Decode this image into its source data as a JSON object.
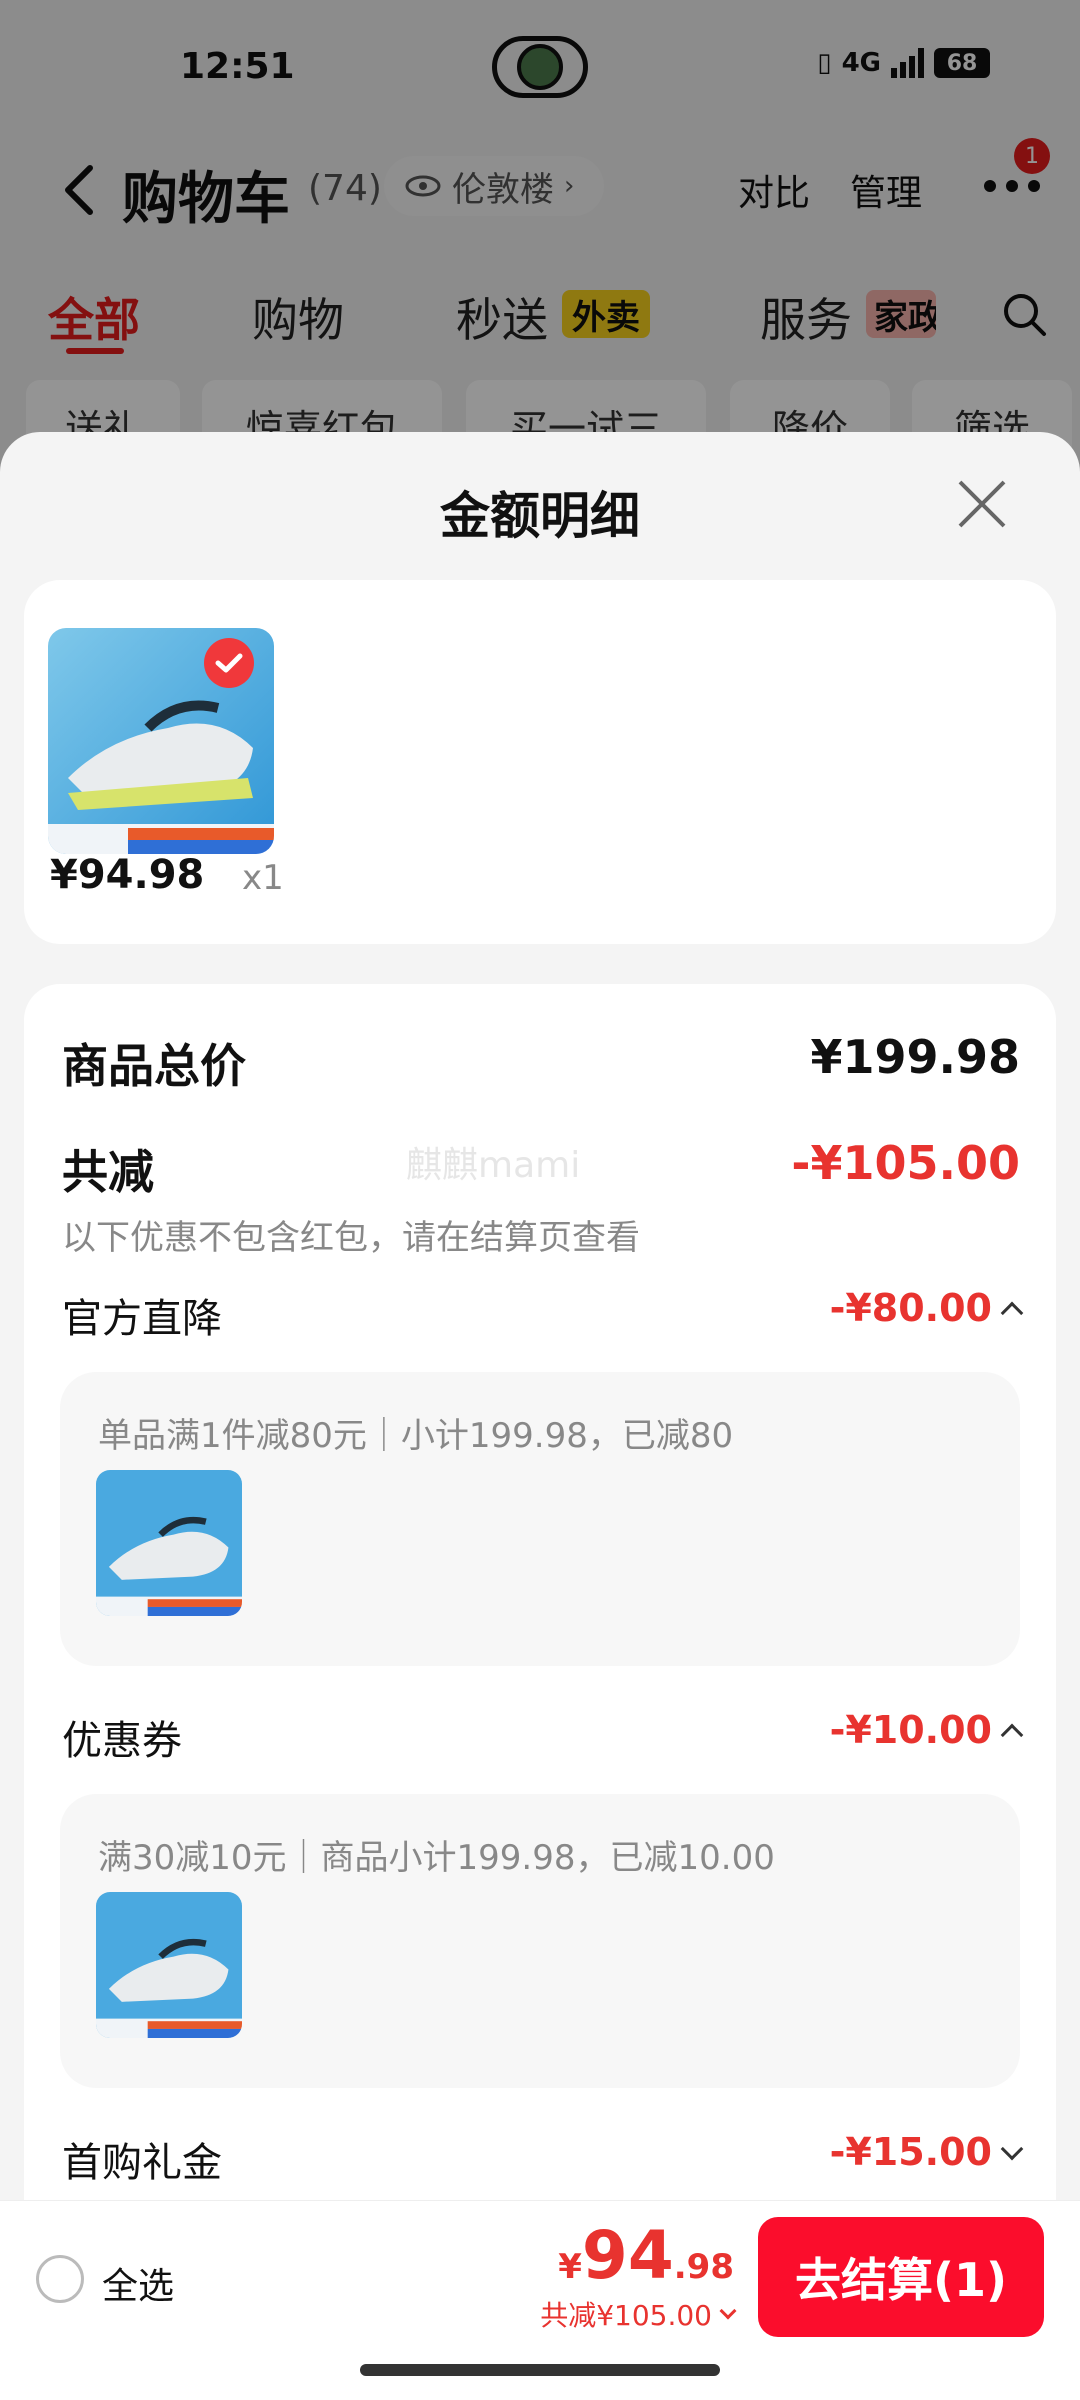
{
  "status": {
    "time": "12:51",
    "network": "4G",
    "battery": "68"
  },
  "header": {
    "title": "购物车",
    "count": "(74)",
    "location": "伦敦楼",
    "compare": "对比",
    "manage": "管理",
    "badge": "1"
  },
  "tabs": [
    {
      "label": "全部"
    },
    {
      "label": "购物"
    },
    {
      "label": "秒送",
      "tag": "外卖"
    },
    {
      "label": "服务",
      "tag": "家政"
    }
  ],
  "chips": [
    "送礼",
    "惊喜红包",
    "买一试三",
    "降价",
    "筛选"
  ],
  "sheet": {
    "title": "金额明细",
    "product": {
      "price": "¥94.98",
      "qty": "x1"
    },
    "total_label": "商品总价",
    "total_value": "¥199.98",
    "reduce_label": "共减",
    "reduce_value": "-¥105.00",
    "note": "以下优惠不包含红包，请在结算页查看",
    "watermark": "麒麒mami",
    "discounts": [
      {
        "label": "官方直降",
        "value": "-¥80.00",
        "expanded": true,
        "detail": "单品满1件减80元｜小计199.98，已减80"
      },
      {
        "label": "优惠券",
        "value": "-¥10.00",
        "expanded": true,
        "detail": "满30减10元｜商品小计199.98，已减10.00"
      },
      {
        "label": "首购礼金",
        "value": "-¥15.00",
        "expanded": false
      }
    ]
  },
  "bottom": {
    "select_all": "全选",
    "price_symbol": "¥",
    "price_int": "94",
    "price_dec": ".98",
    "saved": "共减¥105.00",
    "checkout": "去结算(1)"
  },
  "colors": {
    "accent": "#e8332f",
    "button": "#fb0d2c",
    "tag_yellow": "#f7d11e"
  }
}
